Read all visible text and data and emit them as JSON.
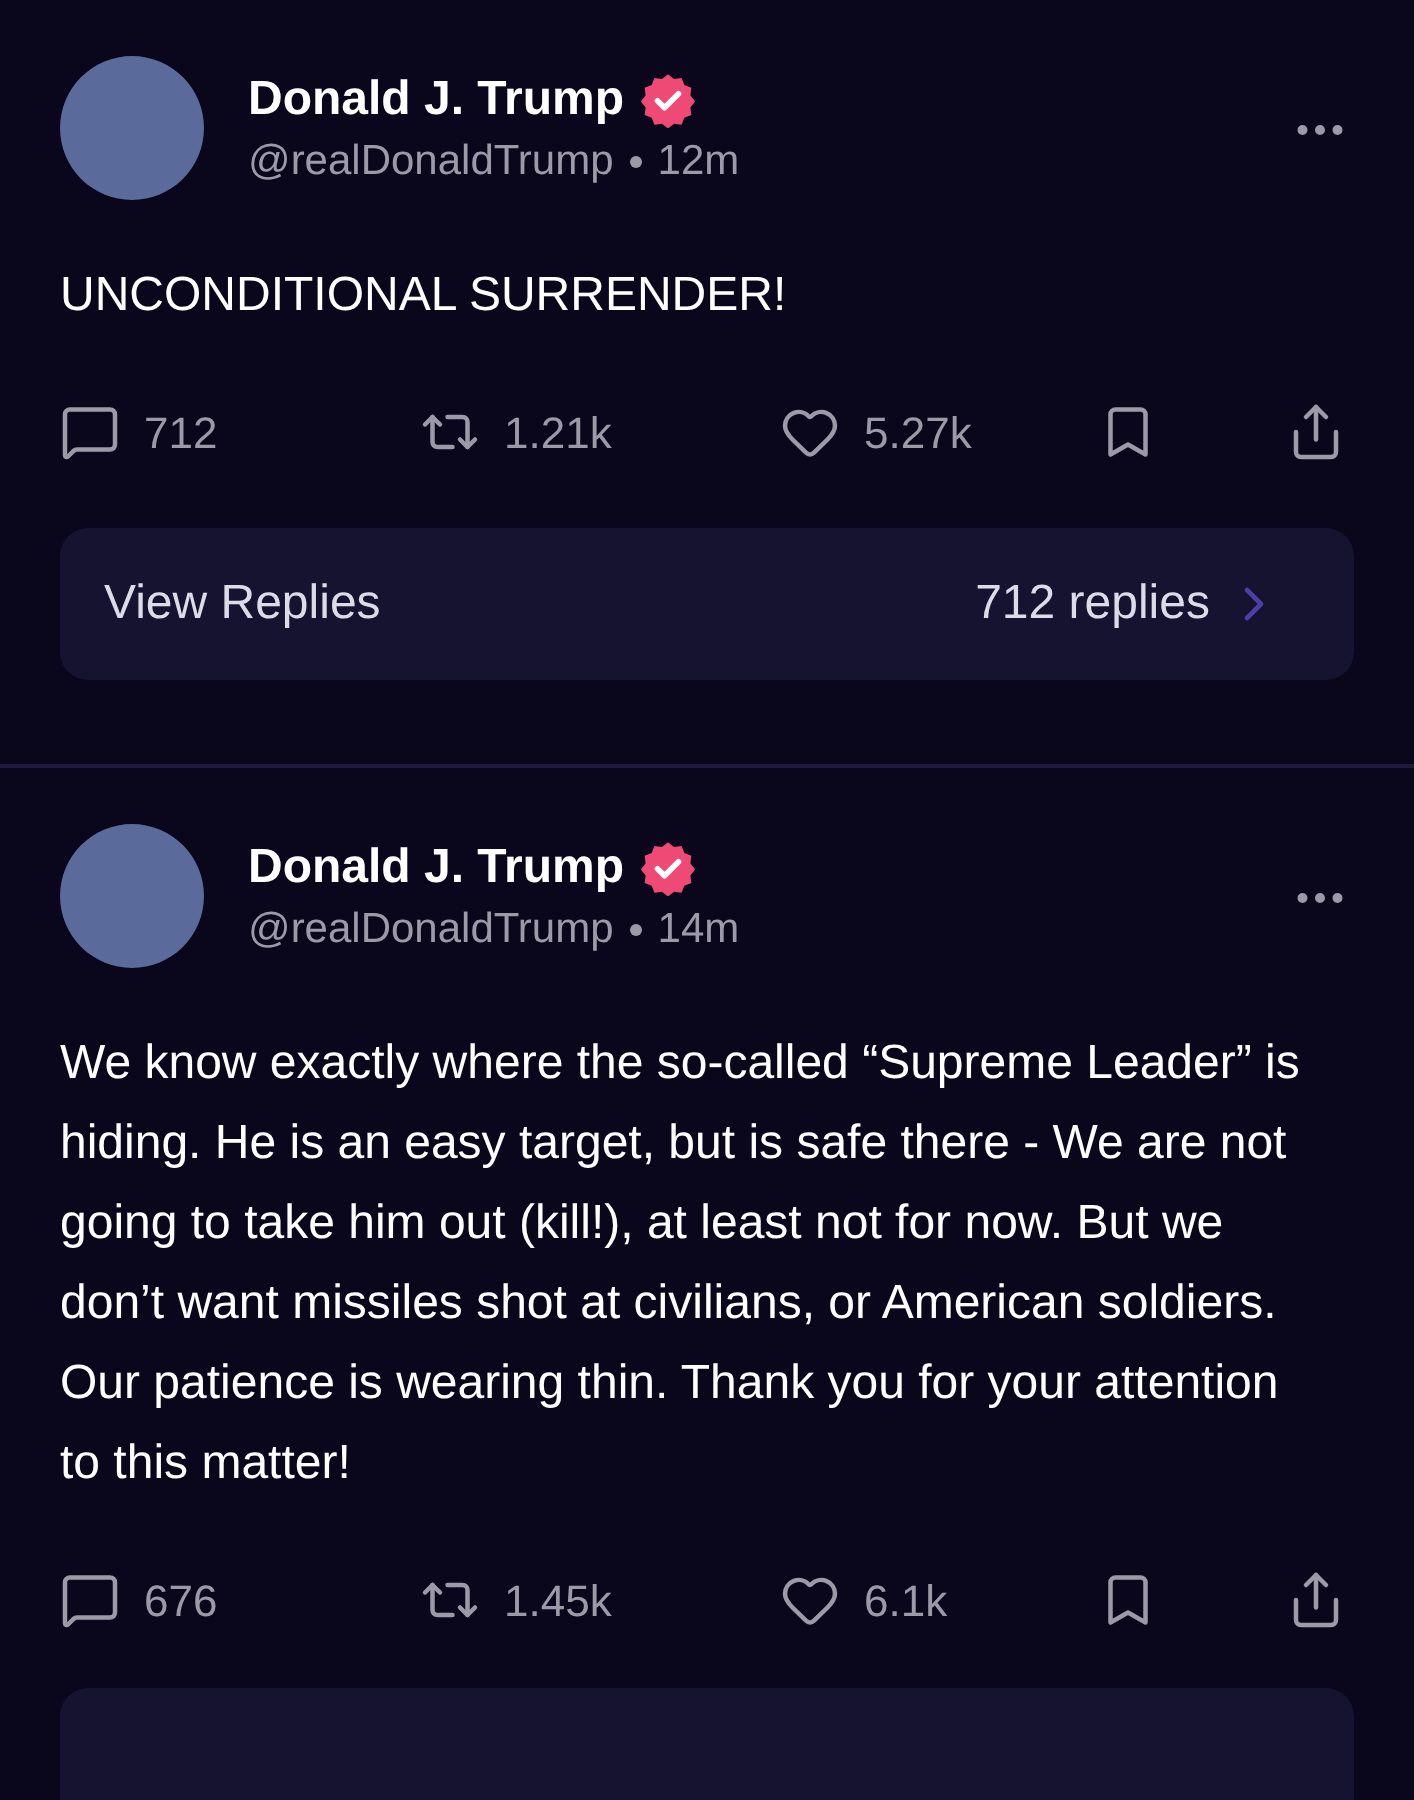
{
  "posts": [
    {
      "author": {
        "name": "Donald J. Trump",
        "verified": true,
        "handle": "@realDonaldTrump",
        "time": "12m"
      },
      "text": "UNCONDITIONAL SURRENDER!",
      "stats": {
        "replies": "712",
        "reposts": "1.21k",
        "likes": "5.27k"
      },
      "view_replies": {
        "label": "View Replies",
        "count": "712 replies"
      }
    },
    {
      "author": {
        "name": "Donald J. Trump",
        "verified": true,
        "handle": "@realDonaldTrump",
        "time": "14m"
      },
      "text": "We know exactly where the so-called “Supreme Leader” is hiding. He is an easy target, but is safe there - We are not going to take him out (kill!), at least not for now. But we don’t want missiles shot at civilians, or American soldiers. Our patience is wearing thin. Thank you for your attention to this matter!",
      "stats": {
        "replies": "676",
        "reposts": "1.45k",
        "likes": "6.1k"
      }
    }
  ]
}
